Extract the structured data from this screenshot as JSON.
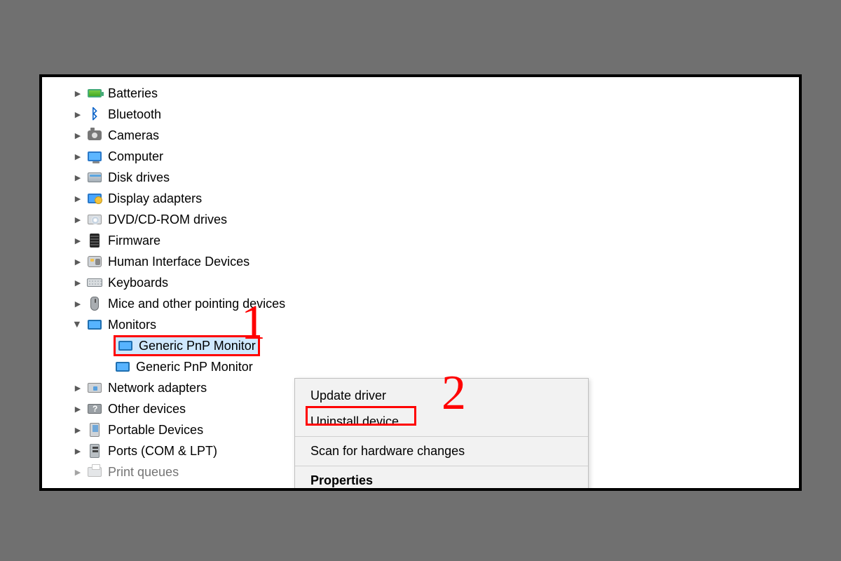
{
  "tree": {
    "batteries": "Batteries",
    "bluetooth": "Bluetooth",
    "cameras": "Cameras",
    "computer": "Computer",
    "disk_drives": "Disk drives",
    "display_adapters": "Display adapters",
    "dvd": "DVD/CD-ROM drives",
    "firmware": "Firmware",
    "hid": "Human Interface Devices",
    "keyboards": "Keyboards",
    "mice": "Mice and other pointing devices",
    "monitors": "Monitors",
    "monitor_child_1": "Generic PnP Monitor",
    "monitor_child_2": "Generic PnP Monitor",
    "network_adapters": "Network adapters",
    "other_devices": "Other devices",
    "portable_devices": "Portable Devices",
    "ports": "Ports (COM & LPT)",
    "print_queues": "Print queues"
  },
  "context_menu": {
    "update_driver": "Update driver",
    "uninstall_device": "Uninstall device",
    "scan_hw": "Scan for hardware changes",
    "properties": "Properties"
  },
  "annotations": {
    "step1": "1",
    "step2": "2"
  }
}
